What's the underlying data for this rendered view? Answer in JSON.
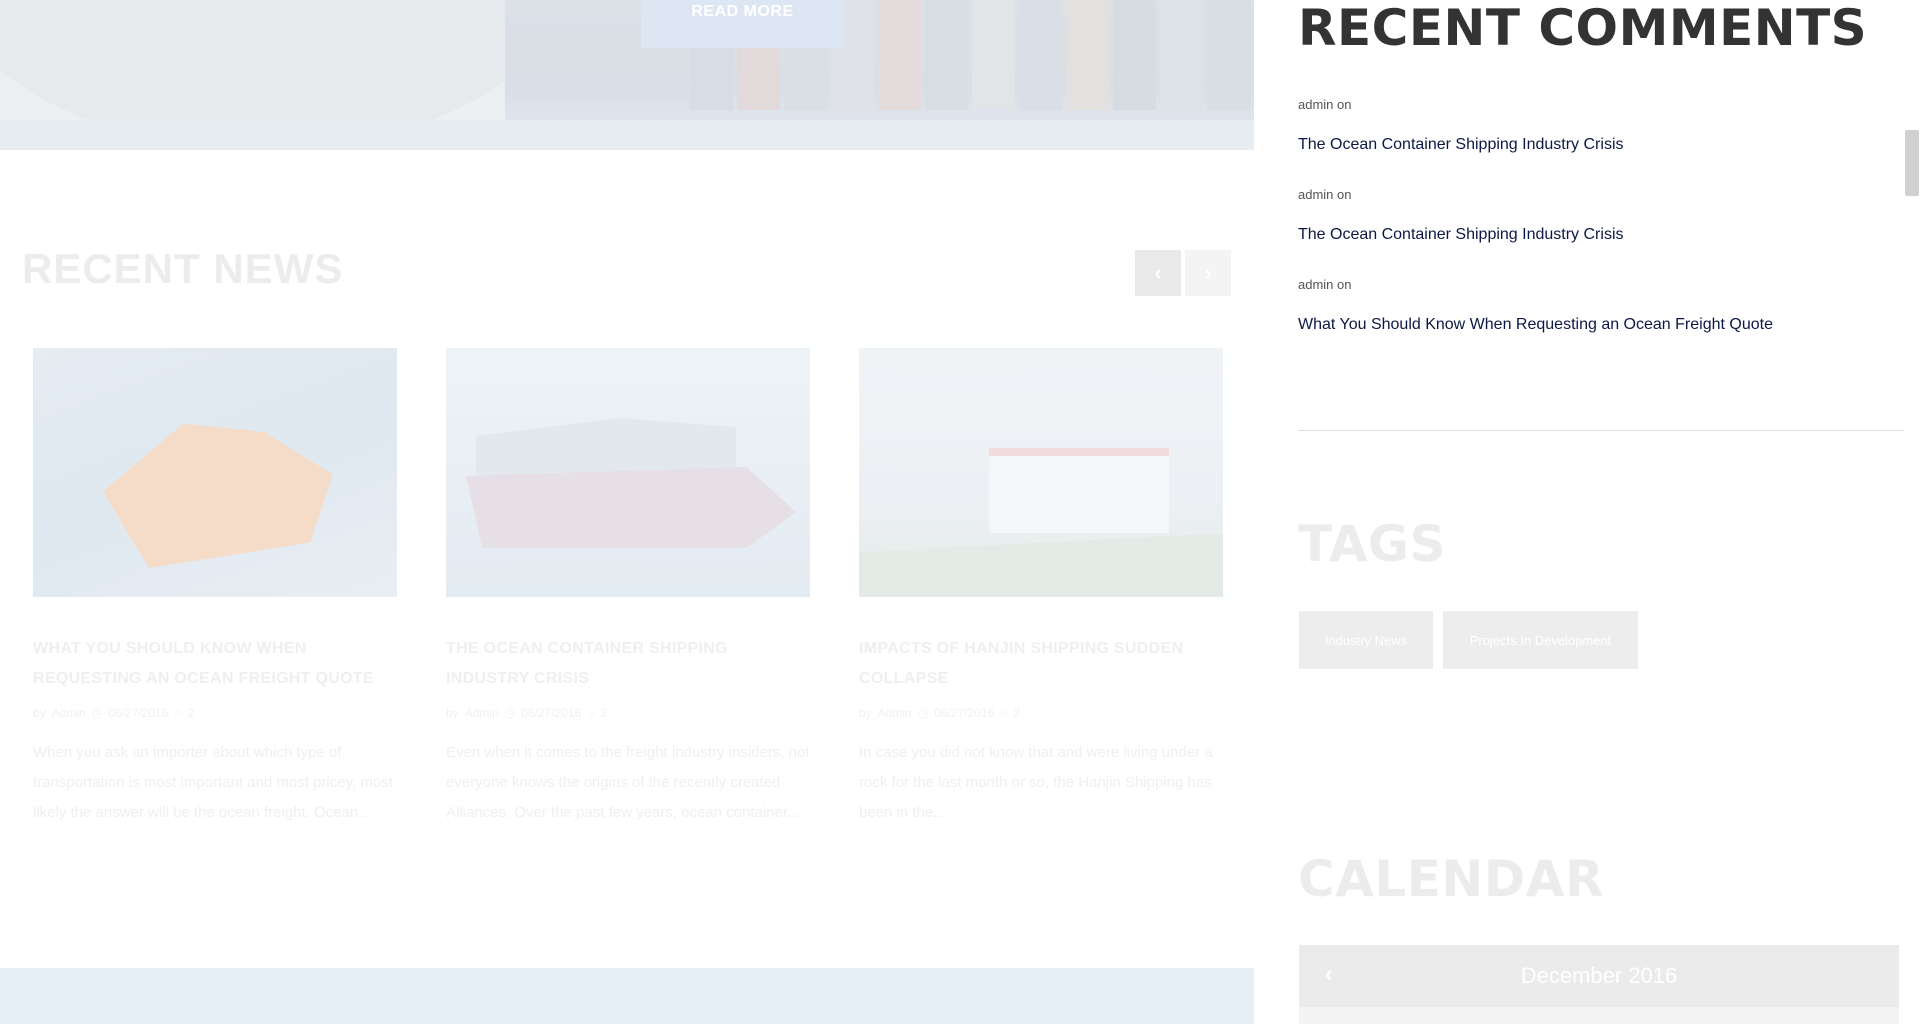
{
  "hero": {
    "read_more_label": "READ MORE"
  },
  "recent_news": {
    "title": "RECENT NEWS",
    "prev_icon": "chevron-left-icon",
    "next_icon": "chevron-right-icon",
    "articles": [
      {
        "title": "WHAT YOU SHOULD KNOW WHEN REQUESTING AN OCEAN FREIGHT QUOTE",
        "by": "by",
        "author": "Admin",
        "date": "06/27/2016",
        "comments": "2",
        "excerpt": "When you ask an importer about which type of transportation is most important and most pricey, most likely the answer will be the ocean freight. Ocean..."
      },
      {
        "title": "THE OCEAN CONTAINER SHIPPING INDUSTRY CRISIS",
        "by": "by",
        "author": "Admin",
        "date": "06/27/2016",
        "comments": "2",
        "excerpt": "Even when it comes to the freight industry insiders, not everyone knows the origins of the recently created Alliances. Over the past few years, ocean container..."
      },
      {
        "title": "IMPACTS OF HANJIN SHIPPING SUDDEN COLLAPSE",
        "by": "by",
        "author": "Admin",
        "date": "06/27/2016",
        "comments": "2",
        "excerpt": "In case you did not know that and were living under a rock for the last month or so, the Hanjin Shipping has been in the..."
      }
    ]
  },
  "sidebar": {
    "recent_comments": {
      "title": "RECENT COMMENTS",
      "items": [
        {
          "author": "admin on",
          "link": "The Ocean Container Shipping Industry Crisis"
        },
        {
          "author": "admin on",
          "link": "The Ocean Container Shipping Industry Crisis"
        },
        {
          "author": "admin on",
          "link": "What You Should Know When Requesting an Ocean Freight Quote"
        }
      ]
    },
    "tags": {
      "title": "TAGS",
      "items": [
        "Industry News",
        "Projects In Development"
      ]
    },
    "calendar": {
      "title": "CALENDAR",
      "month": "December 2016",
      "prev_icon": "chevron-left-icon"
    }
  },
  "colors": {
    "comment_link": "#0b1a45",
    "heading_dark": "#333333",
    "faded_text": "#ececec",
    "tag_background": "#ededed"
  }
}
